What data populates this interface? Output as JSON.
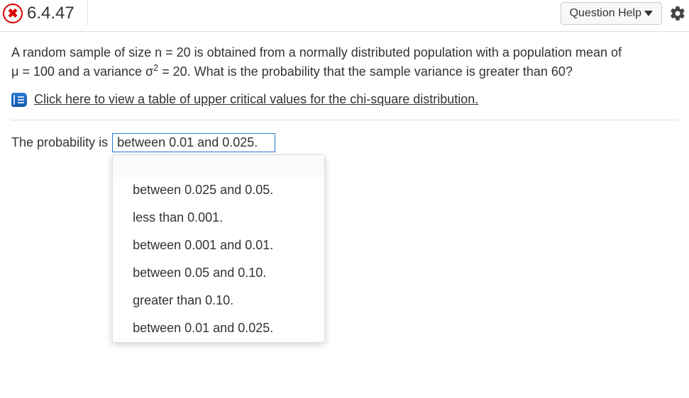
{
  "header": {
    "question_number": "6.4.47",
    "help_label": "Question Help"
  },
  "prompt": {
    "line1_a": "A random sample of size n = 20 is obtained from a normally distributed population with a  population mean of",
    "line2_a": "μ = 100 and a variance σ",
    "line2_sup": "2",
    "line2_b": " = 20. What is the probability that the sample variance is greater than 60?"
  },
  "link": {
    "text": "Click here to view a table of upper critical values for the chi-square distribution."
  },
  "answer": {
    "label": "The probability is",
    "selected": "between 0.01 and 0.025."
  },
  "dropdown": {
    "options": [
      "between 0.025 and 0.05.",
      "less than 0.001.",
      "between 0.001 and 0.01.",
      "between 0.05 and 0.10.",
      "greater than 0.10.",
      "between 0.01 and 0.025."
    ]
  }
}
